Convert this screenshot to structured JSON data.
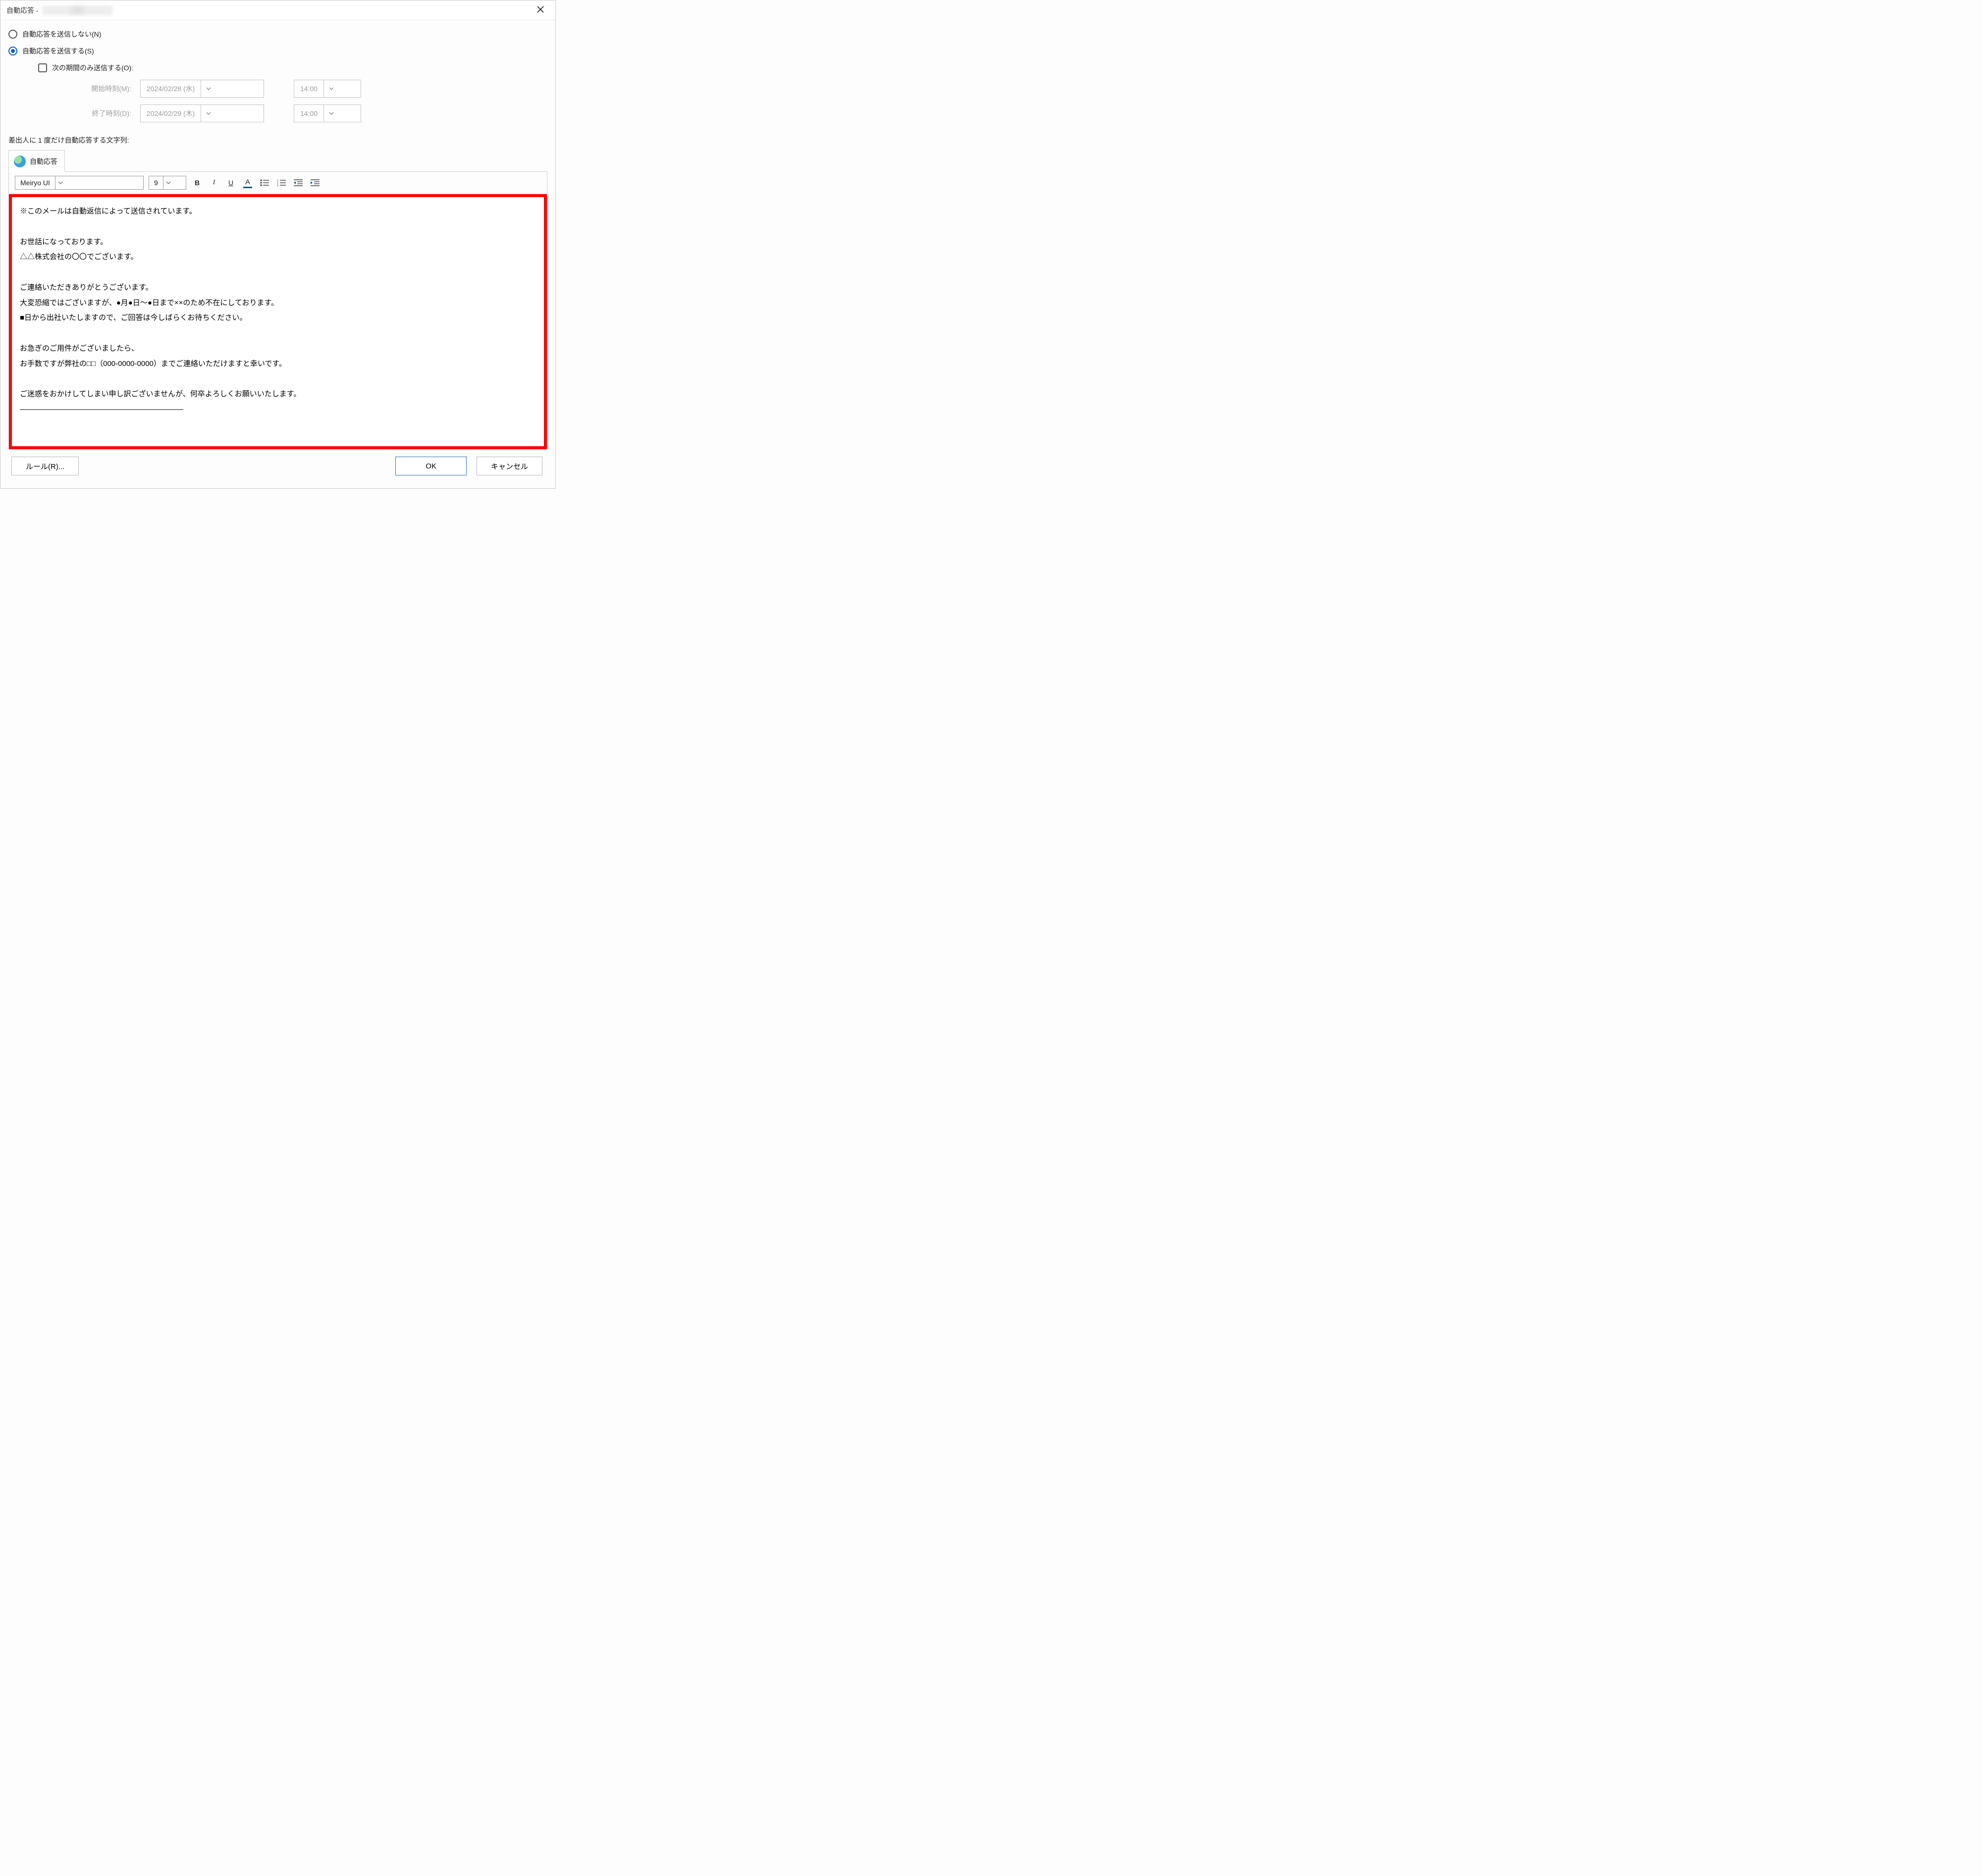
{
  "titlebar": {
    "prefix": "自動応答 - ",
    "account_masked": "xxxxxxxxxxxxxxx"
  },
  "options": {
    "no_send": "自動応答を送信しない(N)",
    "send": "自動応答を送信する(S)",
    "period_only": "次の期間のみ送信する(O):",
    "start_label": "開始時刻(M):",
    "end_label": "終了時刻(D):",
    "start_date": "2024/02/28 (水)",
    "start_time": "14:00",
    "end_date": "2024/02/29 (木)",
    "end_time": "14:00"
  },
  "section_label": "差出人に 1 度だけ自動応答する文字列:",
  "tab_label": "自動応答",
  "toolbar": {
    "font": "Meiryo UI",
    "size": "9",
    "bold": "B",
    "italic": "I",
    "underline": "U",
    "fontcolor": "A"
  },
  "reply_body": "※このメールは自動返信によって送信されています。\n\nお世話になっております。\n△△株式会社の〇〇でございます。\n\nご連絡いただきありがとうございます。\n大変恐縮ではございますが、●月●日～●日まで××のため不在にしております。\n■日から出社いたしますので、ご回答は今しばらくお待ちください。\n\nお急ぎのご用件がございましたら、\nお手数ですが弊社の□□（000-0000-0000）までご連絡いただけますと幸いです。\n\nご迷惑をおかけしてしまい申し訳ございませんが、何卒よろしくお願いいたします。\n――――――――――――――――――――――",
  "footer": {
    "rules": "ルール(R)...",
    "ok": "OK",
    "cancel": "キャンセル"
  }
}
